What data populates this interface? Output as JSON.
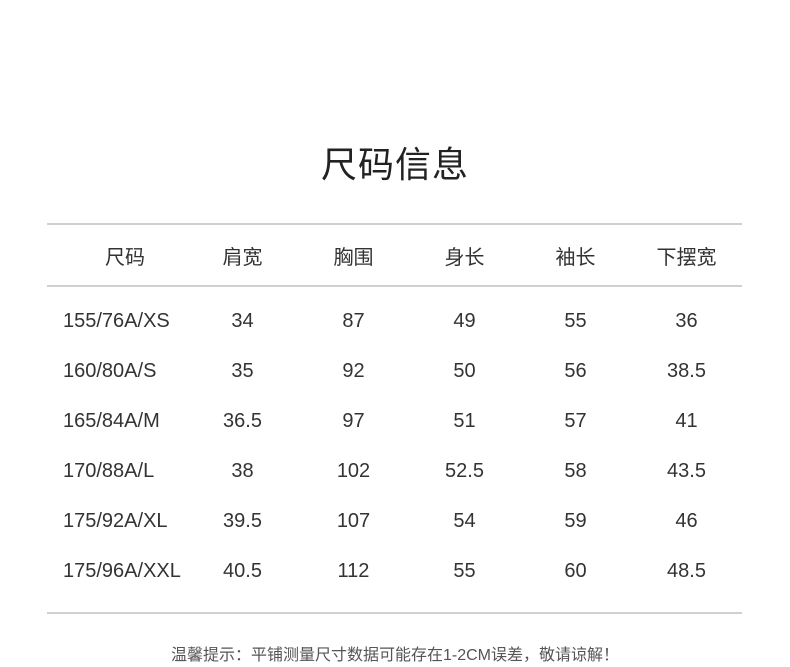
{
  "title": "尺码信息",
  "table": {
    "headers": [
      "尺码",
      "肩宽",
      "胸围",
      "身长",
      "袖长",
      "下摆宽"
    ],
    "rows": [
      [
        "155/76A/XS",
        "34",
        "87",
        "49",
        "55",
        "36"
      ],
      [
        "160/80A/S",
        "35",
        "92",
        "50",
        "56",
        "38.5"
      ],
      [
        "165/84A/M",
        "36.5",
        "97",
        "51",
        "57",
        "41"
      ],
      [
        "170/88A/L",
        "38",
        "102",
        "52.5",
        "58",
        "43.5"
      ],
      [
        "175/92A/XL",
        "39.5",
        "107",
        "54",
        "59",
        "46"
      ],
      [
        "175/96A/XXL",
        "40.5",
        "112",
        "55",
        "60",
        "48.5"
      ]
    ]
  },
  "note": "温馨提示：平铺测量尺寸数据可能存在1-2CM误差，敬请谅解！"
}
